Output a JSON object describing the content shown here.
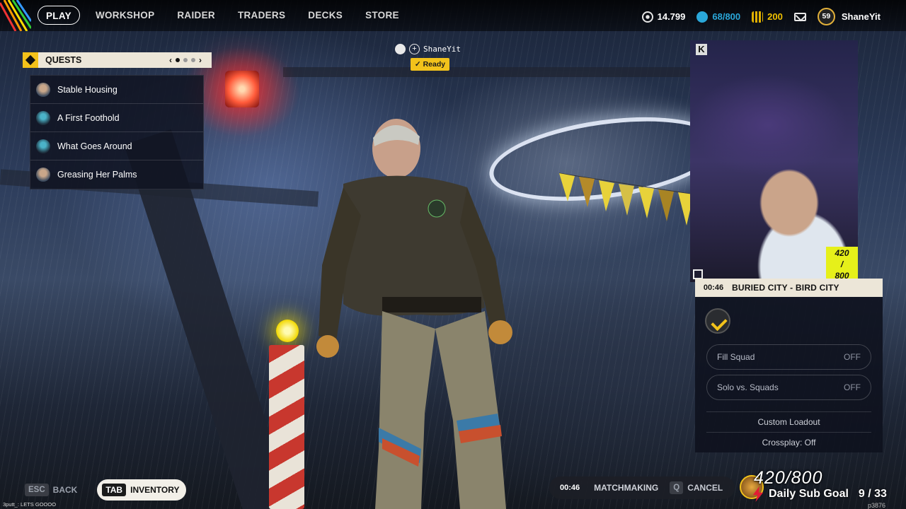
{
  "nav": {
    "items": [
      "PLAY",
      "WORKSHOP",
      "RAIDER",
      "TRADERS",
      "DECKS",
      "STORE"
    ],
    "active": "PLAY"
  },
  "currencies": {
    "coins": "14.799",
    "creds": "68/800",
    "tokens": "200"
  },
  "profile": {
    "level": "59",
    "name": "ShaneYit"
  },
  "quests": {
    "title": "QUESTS",
    "page_indicator": {
      "current": 1,
      "total": 3
    },
    "items": [
      {
        "label": "Stable Housing"
      },
      {
        "label": "A First Foothold"
      },
      {
        "label": "What Goes Around"
      },
      {
        "label": "Greasing Her Palms"
      }
    ]
  },
  "player_tag": {
    "name": "ShaneYit",
    "status": "Ready",
    "plus": "+"
  },
  "webcam": {
    "badge_top": "420",
    "badge_sep": "/",
    "badge_bottom": "800",
    "logo": "K"
  },
  "map_panel": {
    "timer": "00:46",
    "location": "BURIED CITY - BIRD CITY",
    "fill_squad": {
      "label": "Fill Squad",
      "value": "OFF"
    },
    "solo_vs_squads": {
      "label": "Solo vs. Squads",
      "value": "OFF"
    },
    "custom_loadout": "Custom Loadout",
    "crossplay": "Crossplay: Off"
  },
  "bottom": {
    "back_key": "ESC",
    "back_label": "BACK",
    "inventory_key": "TAB",
    "inventory_label": "INVENTORY",
    "mm_timer": "00:46",
    "mm_label": "MATCHMAKING",
    "cancel_key": "Q",
    "cancel_label": "CANCEL"
  },
  "chat": {
    "line": "3putt_: LETS GOOOO"
  },
  "sub_goal": {
    "count": "420/800",
    "label": "Daily Sub Goal",
    "progress": "9 / 33",
    "corner": "p3876"
  },
  "colors": {
    "accent_yellow": "#f2c21b",
    "creds_blue": "#2aa7d9",
    "badge_lime": "#e6f01a",
    "bolt_red": "#e21b34"
  }
}
